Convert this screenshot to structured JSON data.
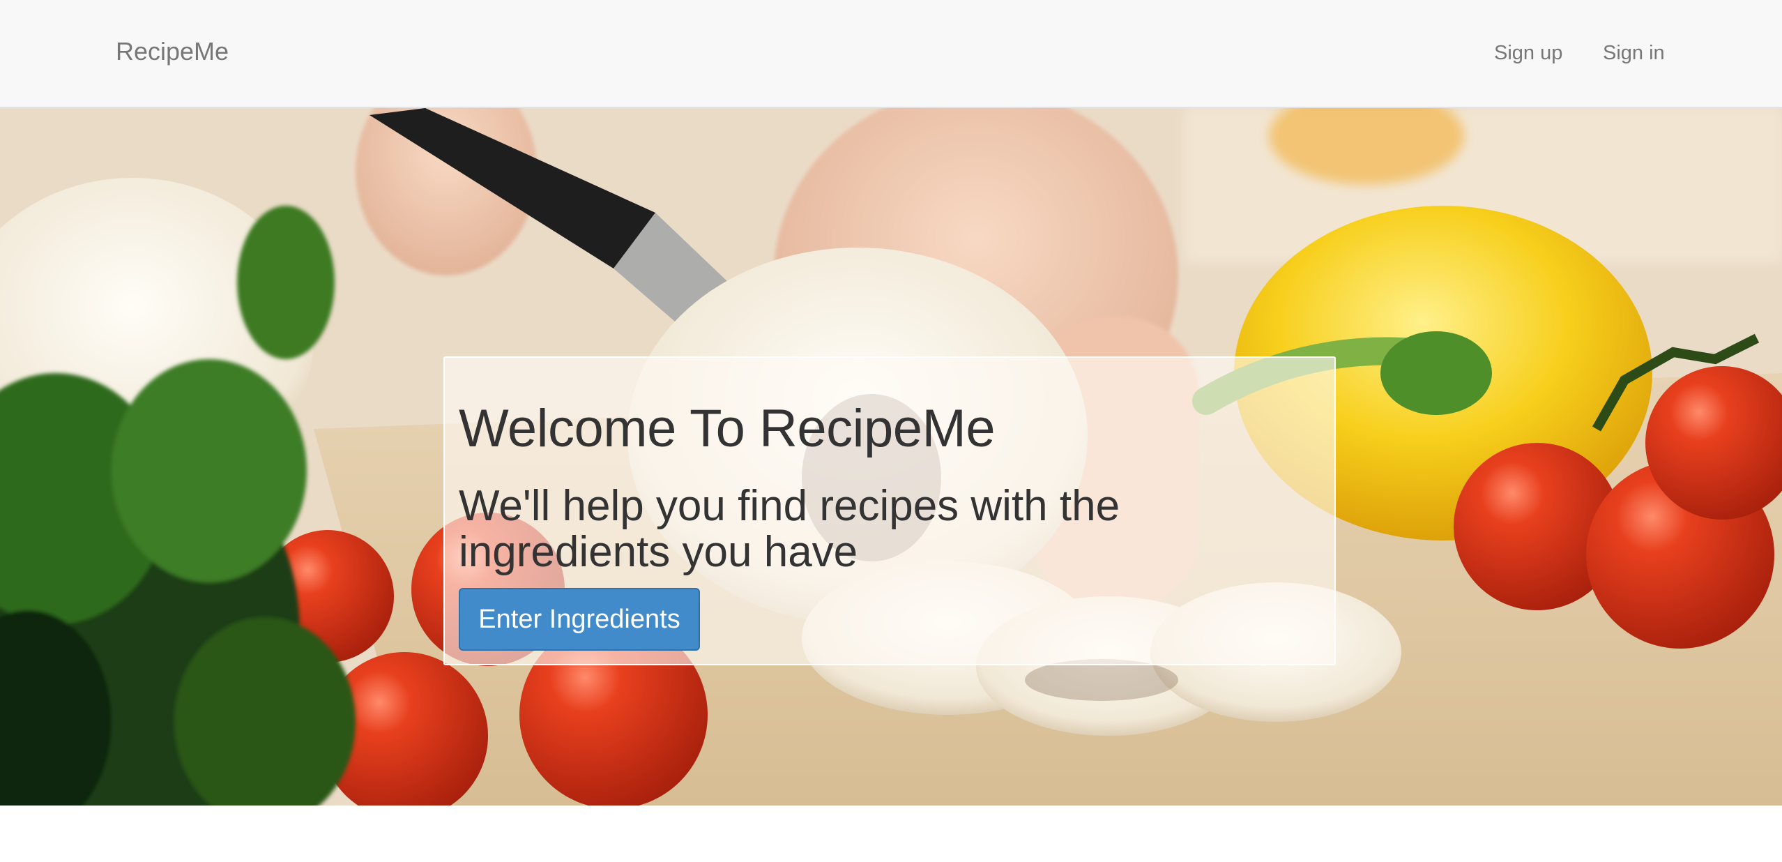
{
  "navbar": {
    "brand": "RecipeMe",
    "links": [
      {
        "label": "Sign up"
      },
      {
        "label": "Sign in"
      }
    ]
  },
  "hero": {
    "title": "Welcome To RecipeMe",
    "subtitle": "We'll help you find recipes with the ingredients you have",
    "cta_label": "Enter Ingredients",
    "background_image": "cooking-ingredients-photo"
  },
  "colors": {
    "navbar_bg": "#f8f8f8",
    "nav_text": "#777777",
    "heading_text": "#333333",
    "primary_button": "#428bca"
  }
}
